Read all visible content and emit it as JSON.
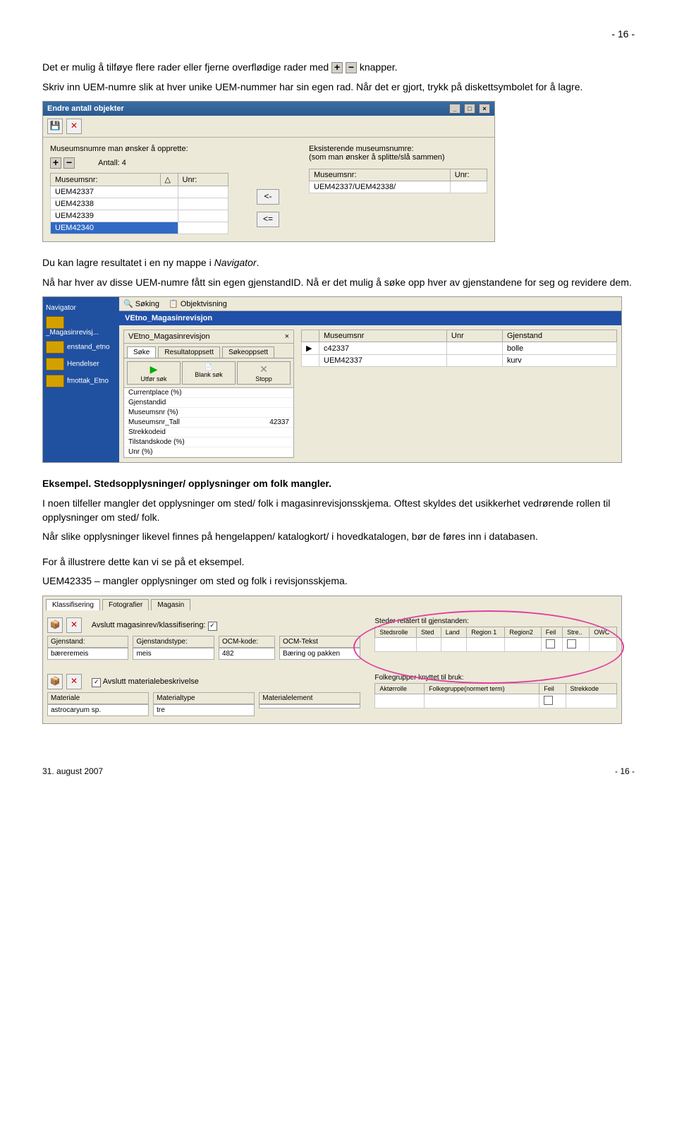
{
  "page_number_top": "- 16 -",
  "para1_a": "Det er mulig å tilføye flere rader eller fjerne overflødige rader med ",
  "para1_b": " knapper.",
  "para2": "Skriv inn UEM-numre slik at hver unike UEM-nummer har sin egen rad. Når det er gjort, trykk på diskettsymbolet for å lagre.",
  "win1": {
    "title": "Endre antall objekter",
    "label_left": "Museumsnumre man ønsker å opprette:",
    "count_label": "Antall: 4",
    "label_right_1": "Eksisterende museumsnumre:",
    "label_right_2": "(som man ønsker å splitte/slå sammen)",
    "cols_left": [
      "Museumsnr:",
      "Unr:"
    ],
    "cols_right": [
      "Museumsnr:",
      "Unr:"
    ],
    "rows_left": [
      "UEM42337",
      "UEM42338",
      "UEM42339",
      "UEM42340"
    ],
    "rows_right": [
      "UEM42337/UEM42338/"
    ],
    "arrow1": "<-",
    "arrow2": "<="
  },
  "para3_a": "Du kan lagre resultatet i en ny mappe i ",
  "para3_b": "Navigator",
  "para3_c": ".",
  "para4": "Nå har hver av disse UEM-numre fått sin egen gjenstandID. Nå er det mulig å søke opp hver av gjenstandene for seg og revidere dem.",
  "win2": {
    "nav_label": "Navigator",
    "tab1": "Søking",
    "tab2": "Objektvisning",
    "title": "VEtno_Magasinrevisjon",
    "sidebar_items": [
      "_Magasinrevisj...",
      "enstand_etno",
      "Hendelser",
      "fmottak_Etno"
    ],
    "panel_title": "VEtno_Magasinrevisjon",
    "subtabs": [
      "Søke",
      "Resultatoppsett",
      "Søkeoppsett"
    ],
    "btn_run": "Utfør søk",
    "btn_blank": "Blank søk",
    "btn_stop": "Stopp",
    "params": [
      {
        "k": "Currentplace (%)",
        "v": ""
      },
      {
        "k": "Gjenstandid",
        "v": ""
      },
      {
        "k": "Museumsnr (%)",
        "v": ""
      },
      {
        "k": "Museumsnr_Tall",
        "v": "42337"
      },
      {
        "k": "Strekkodeid",
        "v": ""
      },
      {
        "k": "Tilstandskode (%)",
        "v": ""
      },
      {
        "k": "Unr (%)",
        "v": ""
      }
    ],
    "result_cols": [
      "Museumsnr",
      "Unr",
      "Gjenstand"
    ],
    "result_rows": [
      {
        "m": "c42337",
        "u": "",
        "g": "bolle"
      },
      {
        "m": "UEM42337",
        "u": "",
        "g": "kurv"
      }
    ]
  },
  "heading1": "Eksempel. Stedsopplysninger/ opplysninger om folk mangler.",
  "para5": "I noen tilfeller mangler det opplysninger om sted/ folk i magasinrevisjonsskjema. Oftest skyldes det usikkerhet vedrørende rollen til opplysninger om sted/ folk.",
  "para6": "Når slike opplysninger likevel finnes på hengelappen/ katalogkort/ i hovedkatalogen, bør de føres inn i databasen.",
  "para7": "For å illustrere dette kan vi se på et eksempel.",
  "para8": "UEM42335 – mangler opplysninger om sted og folk i revisjonsskjema.",
  "win3": {
    "tabs": [
      "Klassifisering",
      "Fotografier",
      "Magasin"
    ],
    "chk_label": "Avslutt magasinrev/klassifisering:",
    "row1": {
      "Gjenstand": "bæreremeis",
      "Gjenstandstype": "meis",
      "OCM-kode": "482",
      "OCM-Tekst": "Bæring og pakken"
    },
    "steder_title": "Steder relatert til gjenstanden:",
    "steder_cols": [
      "Stedsrolle",
      "Sted",
      "Land",
      "Region 1",
      "Region2",
      "Feil",
      "Stre..",
      "OWC"
    ],
    "chk2_label": "Avslutt materialebeskrivelse",
    "row2_cols": [
      "Materiale",
      "Materialtype",
      "Materialelement"
    ],
    "row2": {
      "Materiale": "astrocaryum sp.",
      "Materialtype": "tre",
      "Materialelement": ""
    },
    "folk_title": "Folkegrupper knyttet til bruk:",
    "folk_cols": [
      "Aktørrolle",
      "Folkegruppe(normert term)",
      "Feil",
      "Strekkode"
    ]
  },
  "footer_left": "31. august 2007",
  "footer_right": "- 16 -"
}
